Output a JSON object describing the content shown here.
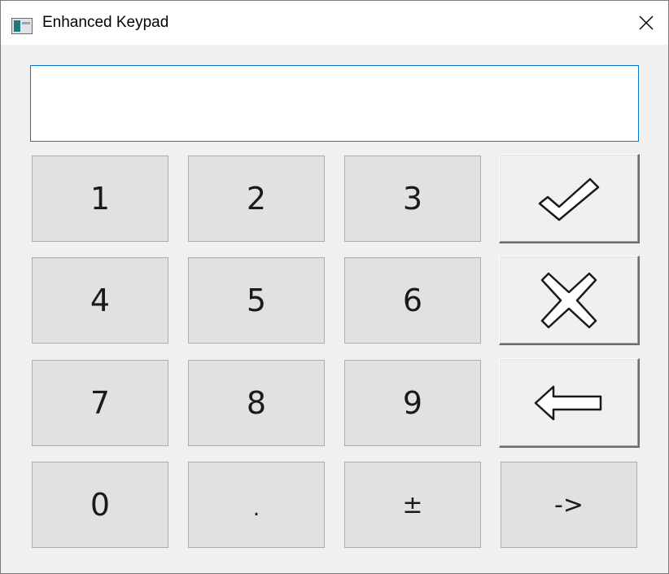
{
  "window": {
    "title": "Enhanced Keypad",
    "icon": "app-window-icon",
    "close_icon": "close-icon",
    "close_glyph": "✕"
  },
  "display": {
    "value": ""
  },
  "keypad": {
    "k1": "1",
    "k2": "2",
    "k3": "3",
    "k4": "4",
    "k5": "5",
    "k6": "6",
    "k7": "7",
    "k8": "8",
    "k9": "9",
    "k0": "0",
    "decimal": ".",
    "sign": "±",
    "next": "->"
  },
  "actions": {
    "confirm_icon": "checkmark-icon",
    "cancel_icon": "x-icon",
    "backspace_icon": "left-arrow-icon"
  },
  "colors": {
    "display_border": "#0078d7",
    "key_face": "#e1e1e1",
    "window_face": "#f0f0f0"
  }
}
